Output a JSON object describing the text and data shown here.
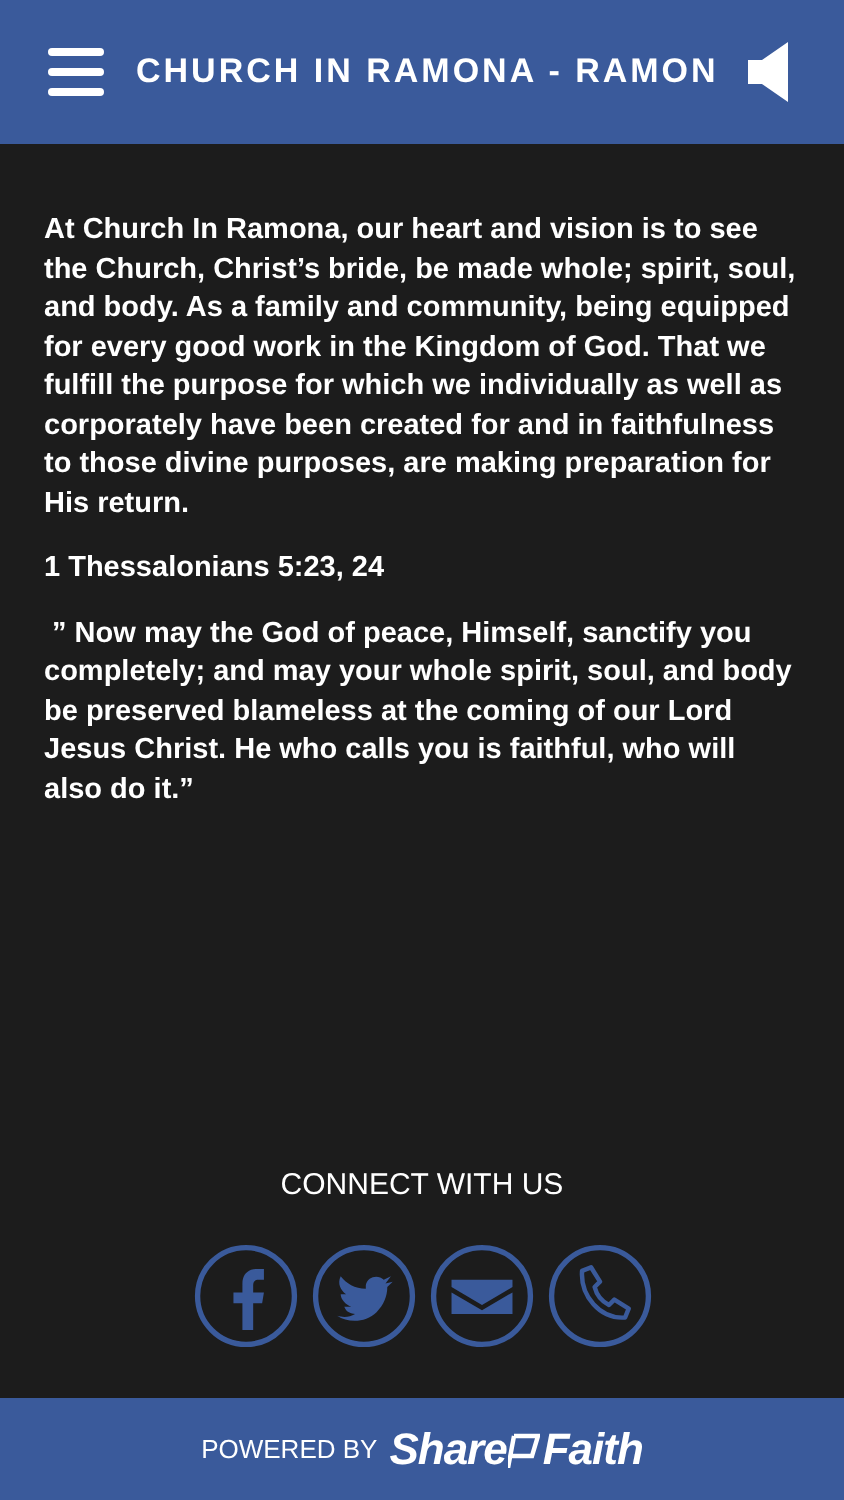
{
  "header": {
    "title": "CHURCH IN RAMONA - RAMON"
  },
  "content": {
    "paragraphs": [
      {
        "kind": "text",
        "text": "At Church In Ramona, our heart and vision is to see the Church, Christ’s bride, be made whole; spirit, soul, and body. As a family and community, being equipped for every good work in the Kingdom of God. That we fulfill the purpose for which we individually as well as corporately have been created for and in faithfulness to those divine purposes, are making preparation for His return."
      },
      {
        "kind": "text",
        "text": "1 Thessalonians 5:23, 24"
      },
      {
        "kind": "text",
        "text": " ” Now may the God of peace, Himself, sanctify you completely; and may your whole spirit, soul, and body be preserved blameless at the coming of our Lord Jesus Christ. He who calls you is faithful, who will also do it.”"
      }
    ]
  },
  "connect": {
    "heading": "CONNECT WITH US",
    "buttons": [
      {
        "kind": "facebook"
      },
      {
        "kind": "twitter"
      },
      {
        "kind": "email"
      },
      {
        "kind": "phone"
      }
    ]
  },
  "footer": {
    "powered_by": "POWERED BY",
    "brand_first": "Share",
    "brand_second": "Faith"
  }
}
